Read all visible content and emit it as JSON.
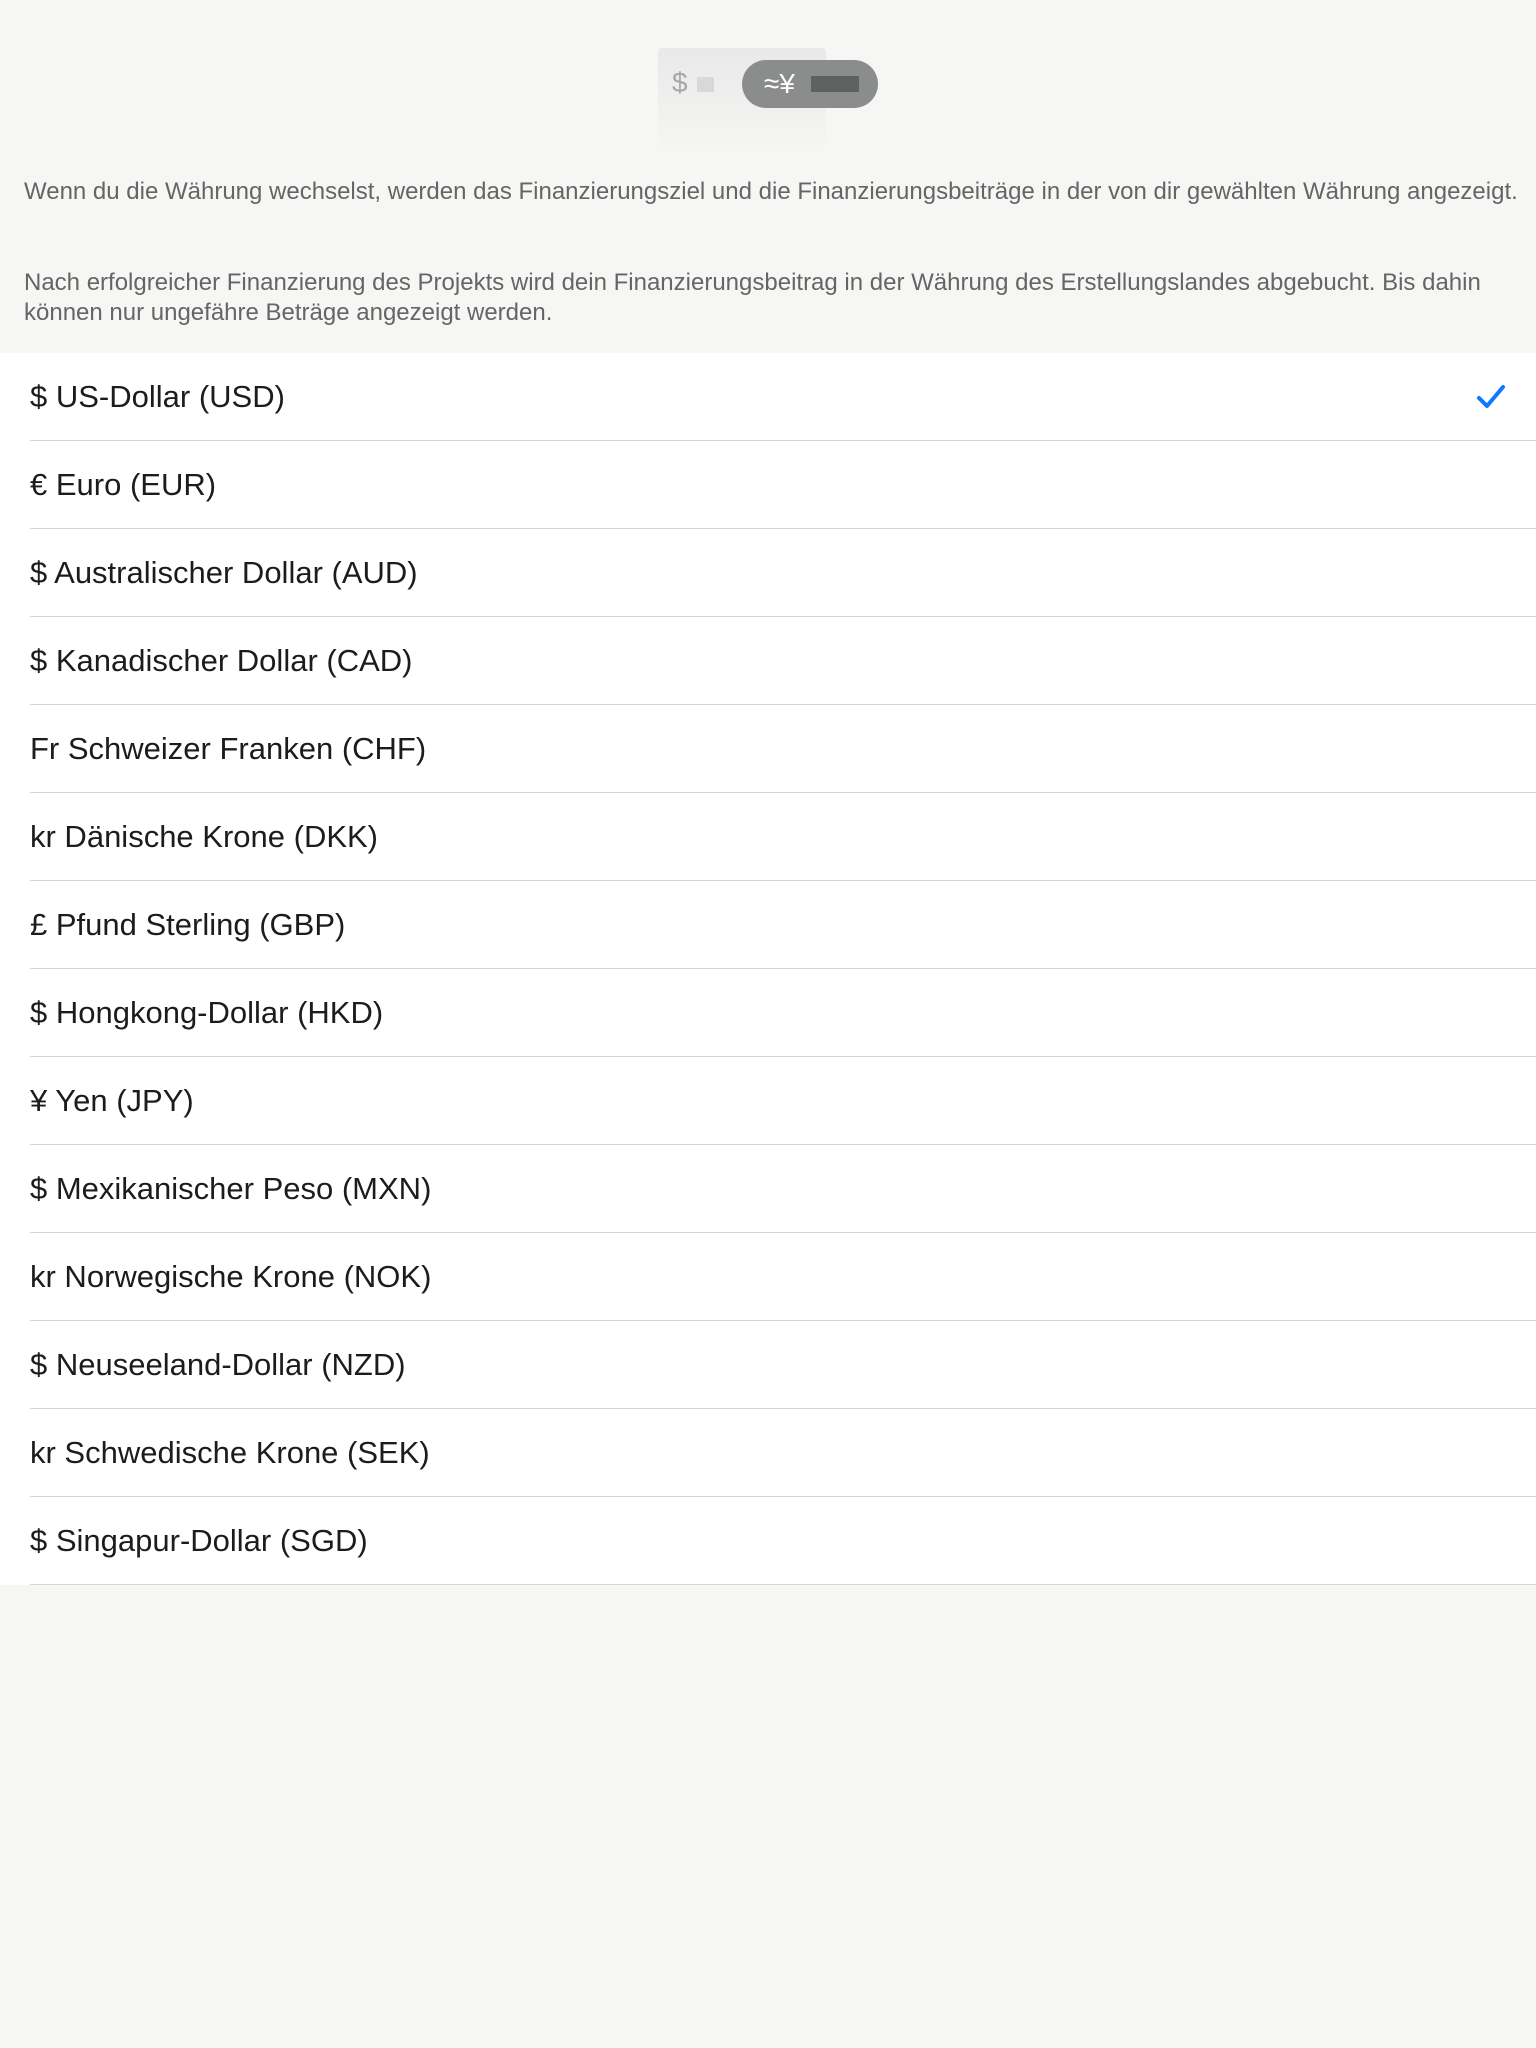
{
  "header": {
    "illustration": {
      "left_symbol": "$",
      "right_symbol": "≈¥"
    },
    "info_paragraph_1": "Wenn du die Währung wechselst, werden das Finanzierungsziel und die Finanzierungsbeiträge in der von dir gewählten Währung angezeigt.",
    "info_paragraph_2": "Nach erfolgreicher Finanzierung des Projekts wird dein Finanzierungsbeitrag in der Währung des Erstellungslandes abgebucht. Bis dahin können nur ungefähre Beträge angezeigt werden."
  },
  "currencies": [
    {
      "label": "$ US-Dollar (USD)",
      "selected": true
    },
    {
      "label": "€ Euro (EUR)",
      "selected": false
    },
    {
      "label": "$ Australischer Dollar (AUD)",
      "selected": false
    },
    {
      "label": "$ Kanadischer Dollar (CAD)",
      "selected": false
    },
    {
      "label": "Fr Schweizer Franken (CHF)",
      "selected": false
    },
    {
      "label": "kr Dänische Krone (DKK)",
      "selected": false
    },
    {
      "label": "£ Pfund Sterling (GBP)",
      "selected": false
    },
    {
      "label": "$ Hongkong-Dollar (HKD)",
      "selected": false
    },
    {
      "label": "¥ Yen (JPY)",
      "selected": false
    },
    {
      "label": "$ Mexikanischer Peso (MXN)",
      "selected": false
    },
    {
      "label": "kr Norwegische Krone (NOK)",
      "selected": false
    },
    {
      "label": "$ Neuseeland-Dollar (NZD)",
      "selected": false
    },
    {
      "label": "kr Schwedische Krone (SEK)",
      "selected": false
    },
    {
      "label": "$ Singapur-Dollar (SGD)",
      "selected": false
    }
  ],
  "colors": {
    "accent": "#0a7aff",
    "background": "#f6f6f5",
    "list_background": "#ffffff",
    "divider": "#d4d4d4",
    "text_primary": "#1c1c1c",
    "text_secondary": "#656565"
  },
  "icons": {
    "selected_indicator": "checkmark-icon"
  }
}
